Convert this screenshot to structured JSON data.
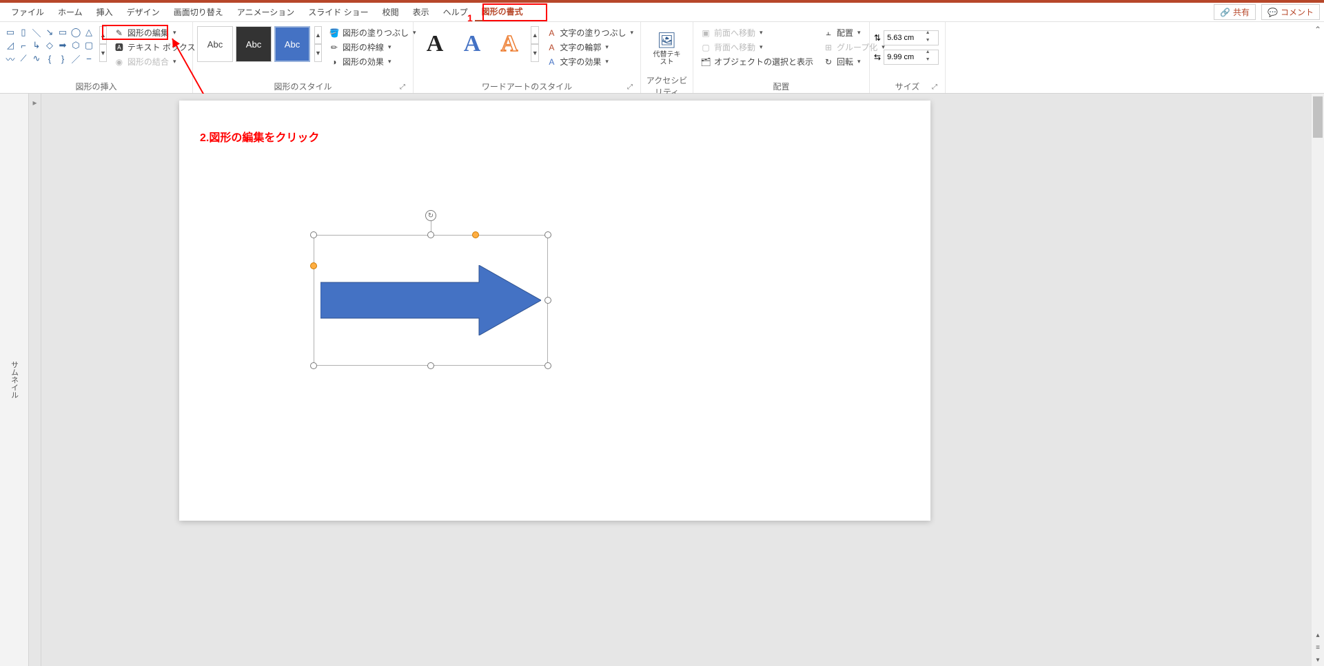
{
  "menubar": {
    "tabs": [
      "ファイル",
      "ホーム",
      "挿入",
      "デザイン",
      "画面切り替え",
      "アニメーション",
      "スライド ショー",
      "校閲",
      "表示",
      "ヘルプ",
      "図形の書式"
    ],
    "active_index": 10,
    "share": "共有",
    "comment": "コメント"
  },
  "ribbon": {
    "insert_shapes": {
      "label": "図形の挿入",
      "edit_shape": "図形の編集",
      "text_box": "テキスト ボックス",
      "merge_shapes": "図形の結合"
    },
    "shape_styles": {
      "label": "図形のスタイル",
      "swatch_text": "Abc",
      "fill": "図形の塗りつぶし",
      "outline": "図形の枠線",
      "effects": "図形の効果"
    },
    "wordart": {
      "label": "ワードアートのスタイル",
      "glyph": "A",
      "text_fill": "文字の塗りつぶし",
      "text_outline": "文字の輪郭",
      "text_effects": "文字の効果"
    },
    "accessibility": {
      "label": "アクセシビリティ",
      "alt_text": "代替テキスト"
    },
    "arrange": {
      "label": "配置",
      "bring_forward": "前面へ移動",
      "send_backward": "背面へ移動",
      "selection_pane": "オブジェクトの選択と表示",
      "align": "配置",
      "group": "グループ化",
      "rotate": "回転"
    },
    "size": {
      "label": "サイズ",
      "height": "5.63 cm",
      "width": "9.99 cm"
    }
  },
  "thumb_label": "サムネイル",
  "annotations": {
    "callout_1": "1",
    "callout_2": "2.図形の編集をクリック"
  }
}
